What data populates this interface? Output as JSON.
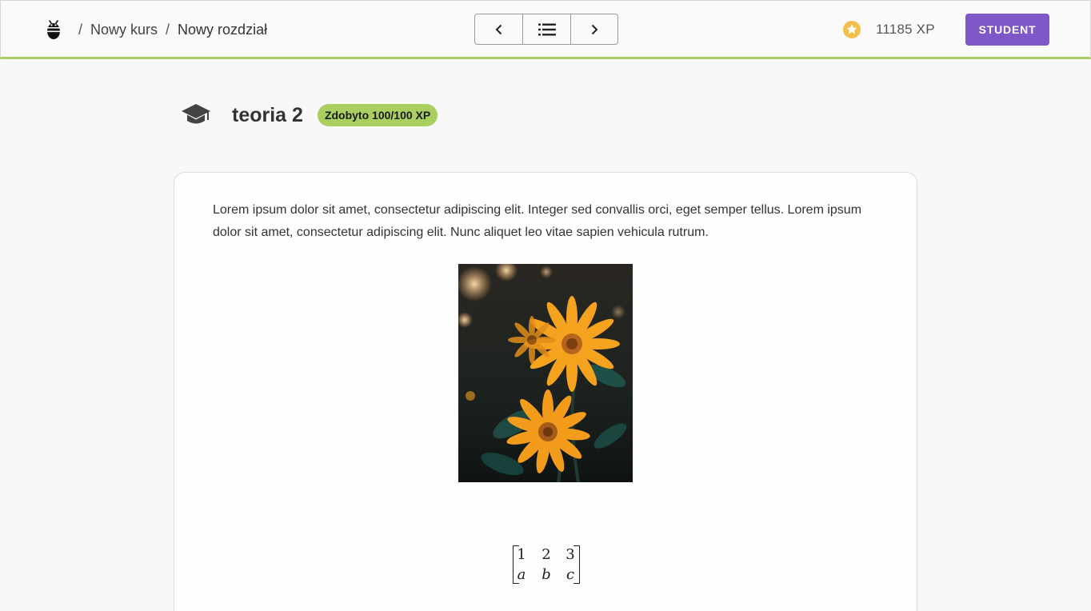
{
  "header": {
    "breadcrumb": [
      {
        "label": "Nowy kurs"
      },
      {
        "label": "Nowy rozdział"
      }
    ],
    "separator": "/",
    "nav": {
      "prev_icon": "chevron-left-icon",
      "list_icon": "list-icon",
      "next_icon": "chevron-right-icon"
    },
    "xp_value": "11185 XP",
    "role_button": "STUDENT"
  },
  "lesson": {
    "title": "teoria 2",
    "badge": "Zdobyto 100/100 XP",
    "icon": "graduation-cap-icon"
  },
  "content": {
    "paragraph": "Lorem ipsum dolor sit amet, consectetur adipiscing elit. Integer sed convallis orci, eget semper tellus. Lorem ipsum dolor sit amet, consectetur adipiscing elit. Nunc aliquet leo vitae sapien vehicula rutrum.",
    "image_icon": "flower-photo",
    "matrix": {
      "row1": [
        "1",
        "2",
        "3"
      ],
      "row2": [
        "a",
        "b",
        "c"
      ]
    }
  },
  "colors": {
    "accent_green": "#a8cf5f",
    "button_purple": "#7e57c9",
    "coin_gold": "#f2c04a"
  }
}
